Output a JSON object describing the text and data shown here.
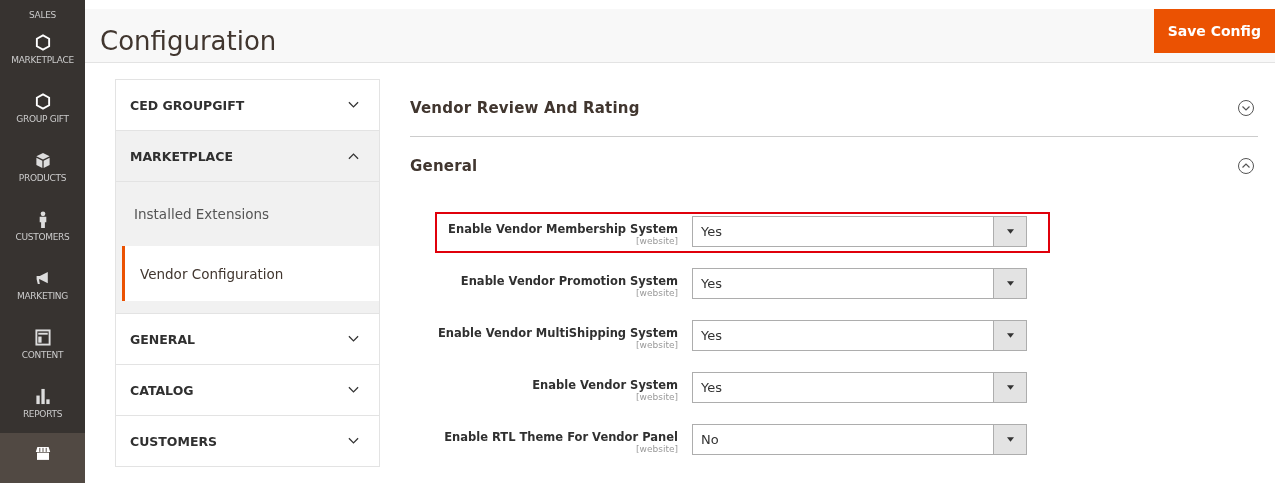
{
  "nav": [
    {
      "label": "SALES",
      "selected": false
    },
    {
      "label": "MARKETPLACE",
      "selected": false
    },
    {
      "label": "GROUP GIFT",
      "selected": false
    },
    {
      "label": "PRODUCTS",
      "selected": false
    },
    {
      "label": "CUSTOMERS",
      "selected": false
    },
    {
      "label": "MARKETING",
      "selected": false
    },
    {
      "label": "CONTENT",
      "selected": false
    },
    {
      "label": "REPORTS",
      "selected": false
    },
    {
      "selected": true
    }
  ],
  "page": {
    "title": "Configuration",
    "save_button": "Save Config"
  },
  "config_tabs": [
    {
      "kind": "group",
      "label": "CED GROUPGIFT",
      "expanded": false
    },
    {
      "kind": "group",
      "label": "MARKETPLACE",
      "expanded": true,
      "children": [
        {
          "label": "Installed Extensions",
          "selected": false
        },
        {
          "label": "Vendor Configuration",
          "selected": true
        }
      ]
    },
    {
      "kind": "group",
      "label": "GENERAL",
      "expanded": false
    },
    {
      "kind": "group",
      "label": "CATALOG",
      "expanded": false
    },
    {
      "kind": "group",
      "label": "CUSTOMERS",
      "expanded": false
    }
  ],
  "sections": [
    {
      "title": "Vendor Review And Rating",
      "expanded": false
    },
    {
      "title": "General",
      "expanded": true,
      "fields": [
        {
          "label": "Enable Vendor Membership System",
          "scope": "[website]",
          "value": "Yes",
          "highlighted": true
        },
        {
          "label": "Enable Vendor Promotion System",
          "scope": "[website]",
          "value": "Yes",
          "highlighted": false
        },
        {
          "label": "Enable Vendor MultiShipping System",
          "scope": "[website]",
          "value": "Yes",
          "highlighted": false
        },
        {
          "label": "Enable Vendor System",
          "scope": "[website]",
          "value": "Yes",
          "highlighted": false
        },
        {
          "label": "Enable RTL Theme For Vendor Panel",
          "scope": "[website]",
          "value": "No",
          "highlighted": false
        }
      ]
    }
  ]
}
